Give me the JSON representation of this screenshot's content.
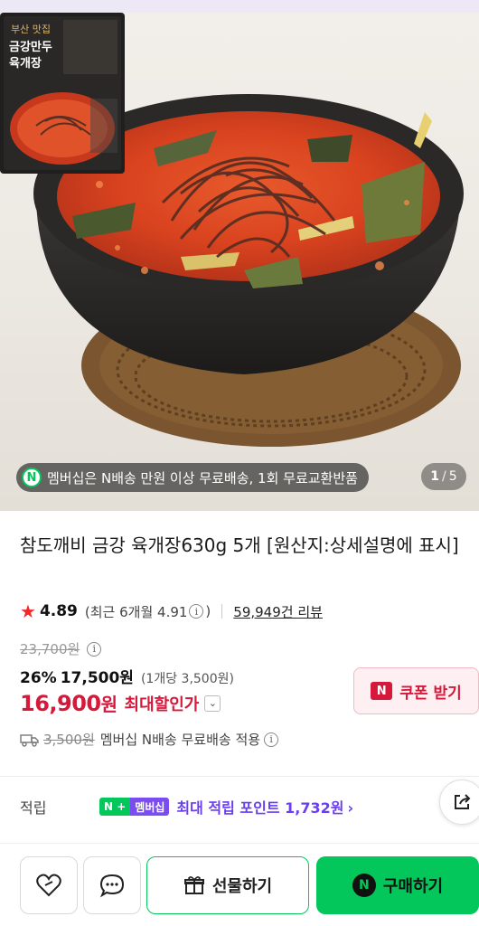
{
  "hero": {
    "banner_text": "멤버십은 N배송 만원 이상 무료배송, 1회 무료교환반품",
    "counter_current": "1",
    "counter_sep": "/",
    "counter_total": "5",
    "package_lines": [
      "부산 맛집",
      "금강만두",
      "육개장"
    ]
  },
  "product": {
    "title": "참도깨비 금강 육개장630g 5개 [원산지:상세설명에 표시]",
    "rating": "4.89",
    "recent_prefix": "(최근 6개월 4.91",
    "recent_suffix": ")",
    "review_count": "59,949건 리뷰",
    "original_price": "23,700원",
    "discount_pct": "26%",
    "sale_price": "17,500원",
    "unit_price": "(1개당 3,500원)",
    "max_price_num": "16,900",
    "max_price_unit": "원",
    "max_label": "최대할인가",
    "coupon_label": "쿠폰 받기",
    "ship_fee": "3,500원",
    "ship_text": "멤버십 N배송 무료배송 적용"
  },
  "points": {
    "label": "적립",
    "badge_n": "N +",
    "badge_member": "멤버십",
    "text": "최대 적립 포인트 1,732원",
    "arrow": "›"
  },
  "bottom": {
    "gift_label": "선물하기",
    "buy_label": "구매하기",
    "buy_icon": "N"
  },
  "colors": {
    "accent_red": "#d6183b",
    "naver_green": "#03c75a",
    "membership_purple": "#6a3ff0"
  },
  "icons": [
    "heart-icon",
    "chat-icon",
    "gift-icon",
    "share-icon",
    "truck-icon",
    "info-icon",
    "chevron-down-icon",
    "star-icon"
  ]
}
